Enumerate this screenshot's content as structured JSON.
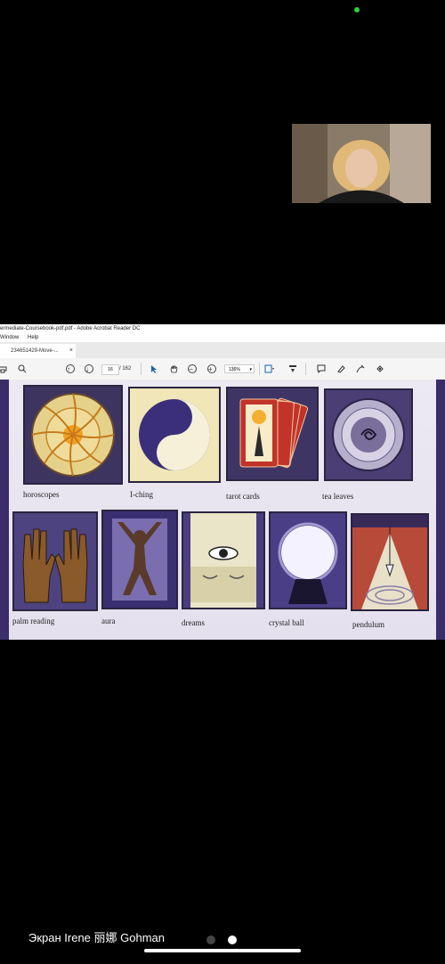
{
  "window": {
    "title": "ermediate-Coursebook-pdf.pdf - Adobe Acrobat Reader DC",
    "menu": [
      "Window",
      "Help"
    ],
    "tab_label": "234651429-Move-...",
    "tab_close": "×"
  },
  "toolbar": {
    "current_page": "16",
    "page_sep_total": "/ 162",
    "zoom": "136%"
  },
  "document": {
    "captions": [
      "horoscopes",
      "I-ching",
      "tarot cards",
      "tea leaves",
      "palm reading",
      "aura",
      "dreams",
      "crystal ball",
      "pendulum"
    ]
  },
  "footer": {
    "screen_label": "Экран Irene 丽娜 Gohman"
  },
  "colors": {
    "status_dot": "#2ecc40",
    "card_frame": "#4a3d7a",
    "page_bg": "#ece9f2"
  }
}
